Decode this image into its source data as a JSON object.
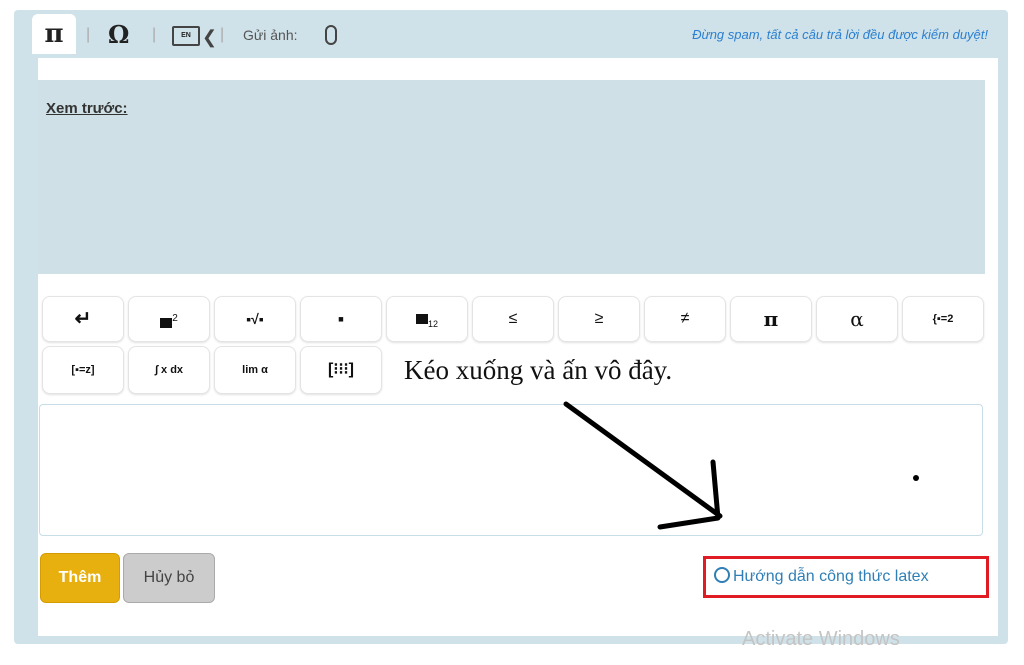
{
  "toolbar": {
    "pi_symbol": "π",
    "omega_symbol": "Ω",
    "keyboard_lang": "EN",
    "separator": "|",
    "send_image_label": "Gửi ảnh:",
    "notice": "Đừng spam, tất cả câu trả lời đều được kiểm duyệt!"
  },
  "preview": {
    "label": "Xem trước:"
  },
  "math_buttons_row1": [
    {
      "name": "newline-button",
      "text": "↵"
    },
    {
      "name": "superscript-button",
      "text": "■²"
    },
    {
      "name": "sqrt-button",
      "text": "√"
    },
    {
      "name": "fraction-button",
      "text": "÷"
    },
    {
      "name": "subscript-button",
      "text": "■₁₂"
    },
    {
      "name": "leq-button",
      "text": "≤"
    },
    {
      "name": "geq-button",
      "text": "≥"
    },
    {
      "name": "neq-button",
      "text": "≠"
    },
    {
      "name": "pi-button",
      "text": "π"
    },
    {
      "name": "alpha-button",
      "text": "α"
    },
    {
      "name": "system-button",
      "text": "{■=2 ■=2"
    }
  ],
  "math_buttons_row2": [
    {
      "name": "bracket-system-button",
      "text": "[■=z ■=z"
    },
    {
      "name": "integral-button",
      "text": "∫ x dx"
    },
    {
      "name": "limit-button",
      "text": "lim α"
    },
    {
      "name": "matrix-button",
      "text": "[⁝⁝⁝]"
    }
  ],
  "annotation": "Kéo xuống và ấn vô đây.",
  "actions": {
    "add_label": "Thêm",
    "cancel_label": "Hủy bỏ"
  },
  "latex_link": "Hướng dẫn công thức latex",
  "watermark": "Activate Windows",
  "colors": {
    "accent_yellow": "#e8b00f",
    "link_blue": "#2f7fb6",
    "highlight_red": "#e01b24",
    "notice_blue": "#2b7fd0"
  }
}
